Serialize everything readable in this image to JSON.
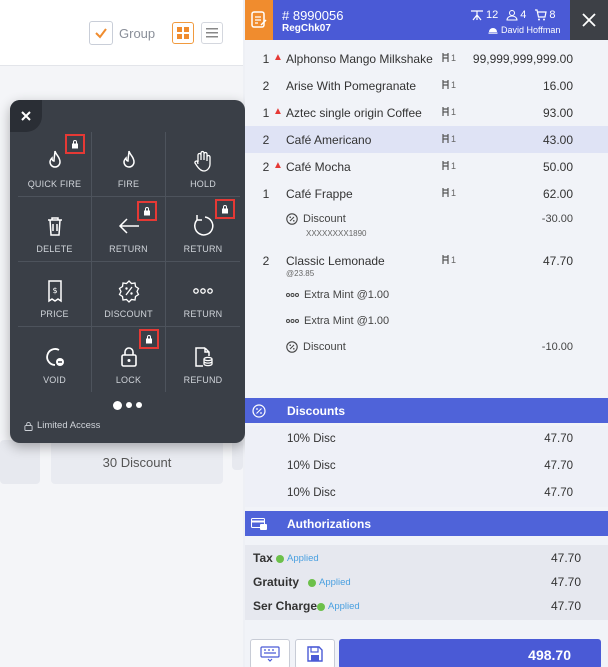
{
  "left": {
    "group_label": "Group",
    "discount_tile": "30 Discount"
  },
  "popup": {
    "actions": [
      {
        "label": "QUICK FIRE",
        "icon": "flame-icon",
        "locked": true
      },
      {
        "label": "FIRE",
        "icon": "flame-icon",
        "locked": false
      },
      {
        "label": "HOLD",
        "icon": "hand-icon",
        "locked": false
      },
      {
        "label": "DELETE",
        "icon": "trash-icon",
        "locked": false
      },
      {
        "label": "RETURN",
        "icon": "arrow-left-icon",
        "locked": true
      },
      {
        "label": "RETURN",
        "icon": "rotate-icon",
        "locked": true
      },
      {
        "label": "PRICE",
        "icon": "receipt-icon",
        "locked": false
      },
      {
        "label": "DISCOUNT",
        "icon": "percent-badge-icon",
        "locked": false
      },
      {
        "label": "RETURN",
        "icon": "more-dots-icon",
        "locked": false
      },
      {
        "label": "VOID",
        "icon": "void-icon",
        "locked": false
      },
      {
        "label": "LOCK",
        "icon": "lock-icon",
        "locked": true
      },
      {
        "label": "REFUND",
        "icon": "refund-icon",
        "locked": false
      }
    ],
    "limited_access": "Limited Access"
  },
  "header": {
    "check_number": "# 8990056",
    "register": "RegChk07",
    "table": "12",
    "guests": "4",
    "items": "8",
    "server": "David Hoffman"
  },
  "order": {
    "items": [
      {
        "qty": "1",
        "fire": true,
        "name": "Alphonso Mango Milkshake",
        "seat": "1",
        "amount": "99,999,999,999.00"
      },
      {
        "qty": "2",
        "fire": false,
        "name": "Arise With Pomegranate",
        "seat": "1",
        "amount": "16.00"
      },
      {
        "qty": "1",
        "fire": true,
        "name": "Aztec single origin Coffee",
        "seat": "1",
        "amount": "93.00"
      },
      {
        "qty": "2",
        "fire": false,
        "name": "Café Americano",
        "seat": "1",
        "amount": "43.00",
        "highlight": true
      },
      {
        "qty": "2",
        "fire": true,
        "name": "Café Mocha",
        "seat": "1",
        "amount": "50.00"
      },
      {
        "qty": "1",
        "fire": false,
        "name": "Café Frappe",
        "seat": "1",
        "amount": "62.00"
      }
    ],
    "frappe_discount": {
      "label": "Discount",
      "note": "XXXXXXXX1890",
      "amount": "-30.00"
    },
    "lemonade": {
      "qty": "2",
      "name": "Classic Lemonade",
      "price_note": "@23.85",
      "seat": "1",
      "amount": "47.70"
    },
    "modifiers": [
      {
        "label": "Extra Mint @1.00"
      },
      {
        "label": "Extra Mint @1.00"
      }
    ],
    "lemonade_discount": {
      "label": "Discount",
      "amount": "-10.00"
    }
  },
  "discounts": {
    "title": "Discounts",
    "rows": [
      {
        "name": "10% Disc",
        "amount": "47.70"
      },
      {
        "name": "10% Disc",
        "amount": "47.70"
      },
      {
        "name": "10% Disc",
        "amount": "47.70"
      }
    ]
  },
  "authorizations": {
    "title": "Authorizations"
  },
  "totals": {
    "rows": [
      {
        "label": "Tax",
        "status": "Applied",
        "amount": "47.70"
      },
      {
        "label": "Gratuity",
        "status": "Applied",
        "amount": "47.70"
      },
      {
        "label": "Ser Charge",
        "status": "Applied",
        "amount": "47.70"
      }
    ],
    "grand_total": "498.70"
  },
  "colors": {
    "primary": "#4a5ad6",
    "accent": "#f08c2e",
    "popup_bg": "#3a3f47",
    "lock_outline": "#e53935",
    "applied": "#6cc04a"
  }
}
